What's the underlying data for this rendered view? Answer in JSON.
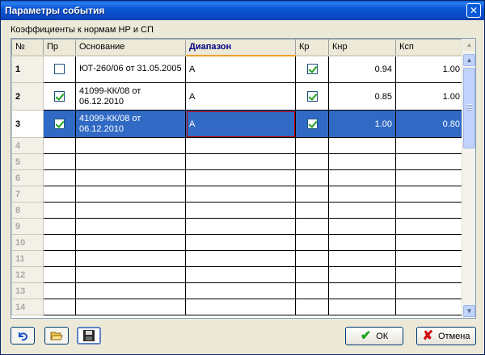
{
  "window": {
    "title": "Параметры события",
    "close_glyph": "✕"
  },
  "section": {
    "label": "Коэффициенты к нормам НР и СП"
  },
  "grid": {
    "columns": [
      "№",
      "Пр",
      "Основание",
      "Диапазон",
      "Кр",
      "Кнр",
      "Ксп"
    ],
    "sorted_column": "Диапазон",
    "rows": [
      {
        "num": "1",
        "pr": false,
        "basis": "ЮТ-260/06 от 31.05.2005",
        "range": "А",
        "kr": true,
        "knr": "0.94",
        "ksp": "1.00"
      },
      {
        "num": "2",
        "pr": true,
        "basis": "41099-КК/08 от 06.12.2010",
        "range": "А",
        "kr": true,
        "knr": "0.85",
        "ksp": "1.00"
      },
      {
        "num": "3",
        "pr": true,
        "basis": "41099-КК/08 от 06.12.2010",
        "range": "А",
        "kr": true,
        "knr": "1.00",
        "ksp": "0.80",
        "selected": true
      }
    ],
    "empty_row_numbers": [
      "4",
      "5",
      "6",
      "7",
      "8",
      "9",
      "10",
      "11",
      "12",
      "13",
      "14"
    ]
  },
  "toolbar": {
    "undo_icon": "undo-icon",
    "open_icon": "folder-open-icon",
    "save_icon": "floppy-disk-icon"
  },
  "buttons": {
    "ok": "ОК",
    "cancel": "Отмена"
  },
  "colors": {
    "title_bar": "#0b56d3",
    "selection": "#316ac5",
    "check": "#21a121",
    "window_bg": "#ece9d8"
  }
}
